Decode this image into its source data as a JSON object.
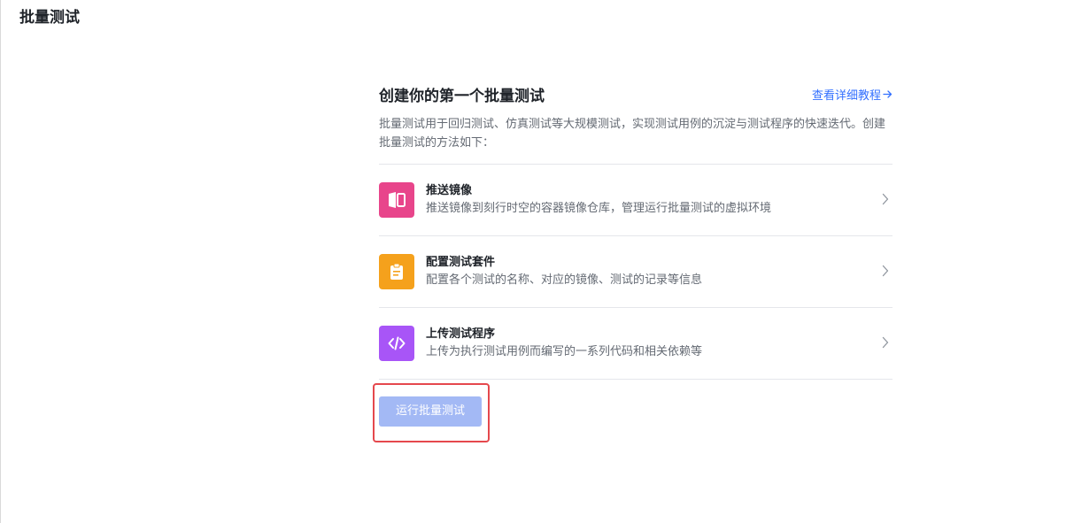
{
  "page": {
    "title": "批量测试"
  },
  "panel": {
    "title": "创建你的第一个批量测试",
    "tutorial_link": "查看详细教程",
    "description": "批量测试用于回归测试、仿真测试等大规模测试，实现测试用例的沉淀与测试程序的快速迭代。创建批量测试的方法如下："
  },
  "steps": [
    {
      "title": "推送镜像",
      "description": "推送镜像到刻行时空的容器镜像仓库，管理运行批量测试的虚拟环境",
      "icon": "image-push-icon",
      "icon_color": "#e8458b"
    },
    {
      "title": "配置测试套件",
      "description": "配置各个测试的名称、对应的镜像、测试的记录等信息",
      "icon": "clipboard-icon",
      "icon_color": "#f5a11c"
    },
    {
      "title": "上传测试程序",
      "description": "上传为执行测试用例而编写的一系列代码和相关依赖等",
      "icon": "code-icon",
      "icon_color": "#a855f7"
    }
  ],
  "actions": {
    "run_label": "运行批量测试",
    "run_enabled": false
  },
  "colors": {
    "accent": "#3370ff",
    "run_button_disabled": "#a3b9f5",
    "highlight": "#e5484d"
  }
}
